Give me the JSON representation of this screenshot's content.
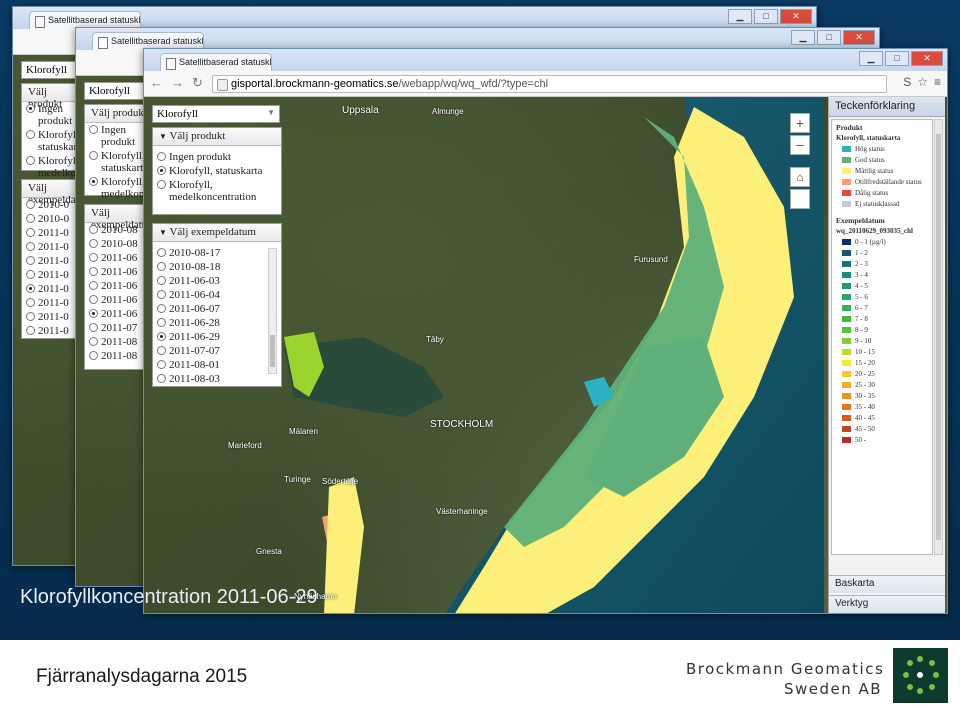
{
  "slide": {
    "caption": "Klorofyllkoncentration 2011-06-29",
    "footer": "Fjärranalysdagarna 2015",
    "brand_line1": "Brockmann Geomatics",
    "brand_line2": "Sweden AB"
  },
  "browser": {
    "tab_title": "Satellitbaserad statusklass",
    "tab_title_back": "Satellitbaserad statusklass",
    "url_host": "gisportal.brockmann-geomatics.se",
    "url_path": "/webapp/wq/wq_wfd/?type=chl"
  },
  "sidebar": {
    "layer_select": "Klorofyll",
    "product_header": "Välj produkt",
    "products": [
      {
        "label": "Ingen produkt",
        "selected": false
      },
      {
        "label": "Klorofyll, statuskarta",
        "selected": true
      },
      {
        "label": "Klorofyll, medelkoncentration",
        "selected": false
      }
    ],
    "back_products": [
      {
        "label": "Ingen produkt",
        "selected": false
      },
      {
        "label": "Klorofyll, statuskarta",
        "selected": false
      },
      {
        "label": "Klorofyll, medelkoncentration",
        "selected": true
      }
    ],
    "back2_products": [
      {
        "label": "Ingen produkt",
        "selected": true
      },
      {
        "label": "Klorofyll, statuskarta",
        "selected": false
      },
      {
        "label": "Klorofyll, medelkoncentration",
        "selected": false
      }
    ],
    "date_header": "Välj exempeldatum",
    "dates": [
      {
        "label": "2010-08-17",
        "selected": false
      },
      {
        "label": "2010-08-18",
        "selected": false
      },
      {
        "label": "2011-06-03",
        "selected": false
      },
      {
        "label": "2011-06-04",
        "selected": false
      },
      {
        "label": "2011-06-07",
        "selected": false
      },
      {
        "label": "2011-06-28",
        "selected": false
      },
      {
        "label": "2011-06-29",
        "selected": true
      },
      {
        "label": "2011-07-07",
        "selected": false
      },
      {
        "label": "2011-08-01",
        "selected": false
      },
      {
        "label": "2011-08-03",
        "selected": false
      }
    ],
    "back_dates": [
      {
        "label": "2010-08",
        "selected": false
      },
      {
        "label": "2010-08",
        "selected": false
      },
      {
        "label": "2011-06",
        "selected": false
      },
      {
        "label": "2011-06",
        "selected": false
      },
      {
        "label": "2011-06",
        "selected": false
      },
      {
        "label": "2011-06",
        "selected": false
      },
      {
        "label": "2011-06",
        "selected": true
      },
      {
        "label": "2011-07",
        "selected": false
      },
      {
        "label": "2011-08",
        "selected": false
      },
      {
        "label": "2011-08",
        "selected": false
      }
    ],
    "back2_dates": [
      {
        "label": "2010-0",
        "selected": false
      },
      {
        "label": "2010-0",
        "selected": false
      },
      {
        "label": "2011-0",
        "selected": false
      },
      {
        "label": "2011-0",
        "selected": false
      },
      {
        "label": "2011-0",
        "selected": false
      },
      {
        "label": "2011-0",
        "selected": false
      },
      {
        "label": "2011-0",
        "selected": true
      },
      {
        "label": "2011-0",
        "selected": false
      },
      {
        "label": "2011-0",
        "selected": false
      },
      {
        "label": "2011-0",
        "selected": false
      }
    ]
  },
  "map": {
    "labels": [
      "Uppsala",
      "Almunge",
      "Täby",
      "STOCKHOLM",
      "Södertälje",
      "Mälaren",
      "Turinge",
      "Västerhaninge",
      "Gnesta",
      "Furusund",
      "Marieford",
      "Nynäshamn"
    ],
    "zoom_in": "+",
    "zoom_out": "−",
    "home_icon": "home-icon"
  },
  "legend": {
    "title": "Teckenförklaring",
    "product_section": "Produkt",
    "status_sub": "Klorofyll, statuskarta",
    "status_items": [
      {
        "label": "Hög status",
        "color": "#2bb3c4"
      },
      {
        "label": "God status",
        "color": "#5fb07a"
      },
      {
        "label": "Måttlig status",
        "color": "#fdf07a"
      },
      {
        "label": "Otillfredställande status",
        "color": "#f4a070"
      },
      {
        "label": "Dålig status",
        "color": "#e8473f"
      },
      {
        "label": "Ej statusklassad",
        "color": "#c9c9c9"
      }
    ],
    "date_section": "Exempeldatum",
    "layer_name": "wq_20110629_093035_chl",
    "conc_items": [
      {
        "label": "0 - 1 (µg/l)",
        "color": "#0b2e6f"
      },
      {
        "label": "1 - 2",
        "color": "#16557a"
      },
      {
        "label": "2 - 3",
        "color": "#1b7182"
      },
      {
        "label": "3 - 4",
        "color": "#1f8a80"
      },
      {
        "label": "4 - 5",
        "color": "#26987a"
      },
      {
        "label": "5 - 6",
        "color": "#2ca66d"
      },
      {
        "label": "6 - 7",
        "color": "#33b159"
      },
      {
        "label": "7 - 8",
        "color": "#3bbd44"
      },
      {
        "label": "8 - 9",
        "color": "#52c634"
      },
      {
        "label": "9 - 10",
        "color": "#7ed02e"
      },
      {
        "label": "10 - 15",
        "color": "#b9dc2b"
      },
      {
        "label": "15 - 20",
        "color": "#f3ea2c"
      },
      {
        "label": "20 - 25",
        "color": "#f4cd24"
      },
      {
        "label": "25 - 30",
        "color": "#f1b21f"
      },
      {
        "label": "30 - 35",
        "color": "#ec951c"
      },
      {
        "label": "35 - 40",
        "color": "#e3771c"
      },
      {
        "label": "40 - 45",
        "color": "#d75a1e"
      },
      {
        "label": "45 - 50",
        "color": "#c94222"
      },
      {
        "label": "50 -",
        "color": "#b42c25"
      }
    ],
    "baskarta": "Baskarta",
    "verktyg": "Verktyg"
  }
}
